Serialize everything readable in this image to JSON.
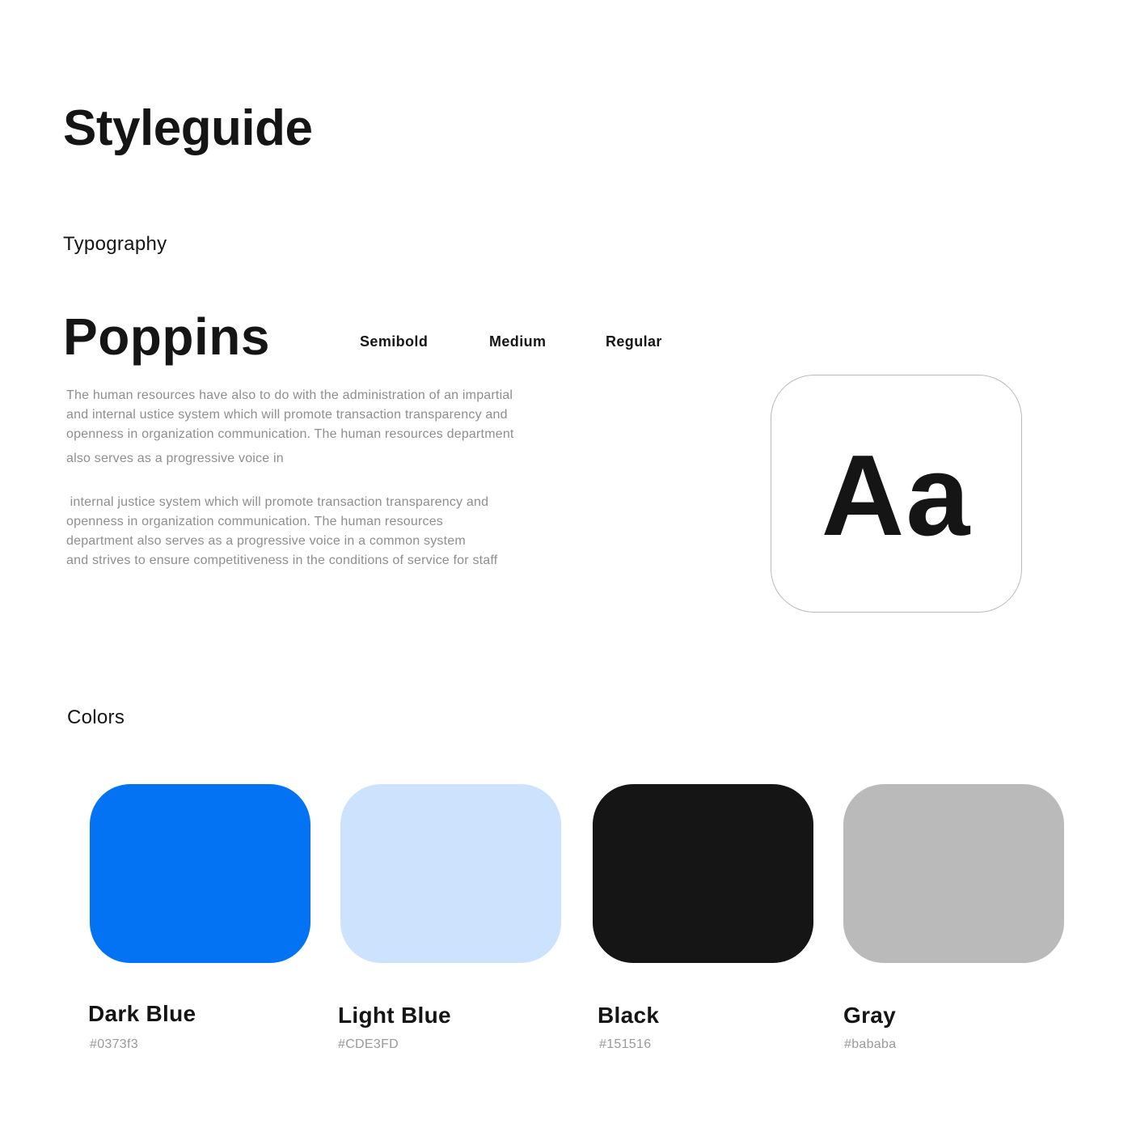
{
  "title": "Styleguide",
  "typography": {
    "heading": "Typography",
    "font_name": "Poppins",
    "weights": [
      "Semibold",
      "Medium",
      "Regular"
    ],
    "paragraph_1": [
      "The human resources have also to do with the administration of an impartial",
      "and internal ustice system which will promote transaction transparency and",
      "openness in organization communication. The human resources department",
      "also serves as a progressive voice in"
    ],
    "paragraph_2": [
      " internal justice system which will promote transaction transparency and",
      "openness in organization communication. The human resources",
      "department also serves as a progressive voice in a common system",
      "and strives to ensure competitiveness in the conditions of service for staff"
    ],
    "sample_glyph": "Aa"
  },
  "colors": {
    "heading": "Colors",
    "swatches": [
      {
        "name": "Dark Blue",
        "hex_label": "#0373f3",
        "color": "#0373f3"
      },
      {
        "name": "Light Blue",
        "hex_label": "#CDE3FD",
        "color": "#CDE3FD"
      },
      {
        "name": "Black",
        "hex_label": "#151516",
        "color": "#151516"
      },
      {
        "name": "Gray",
        "hex_label": "#bababa",
        "color": "#bababa"
      }
    ]
  }
}
